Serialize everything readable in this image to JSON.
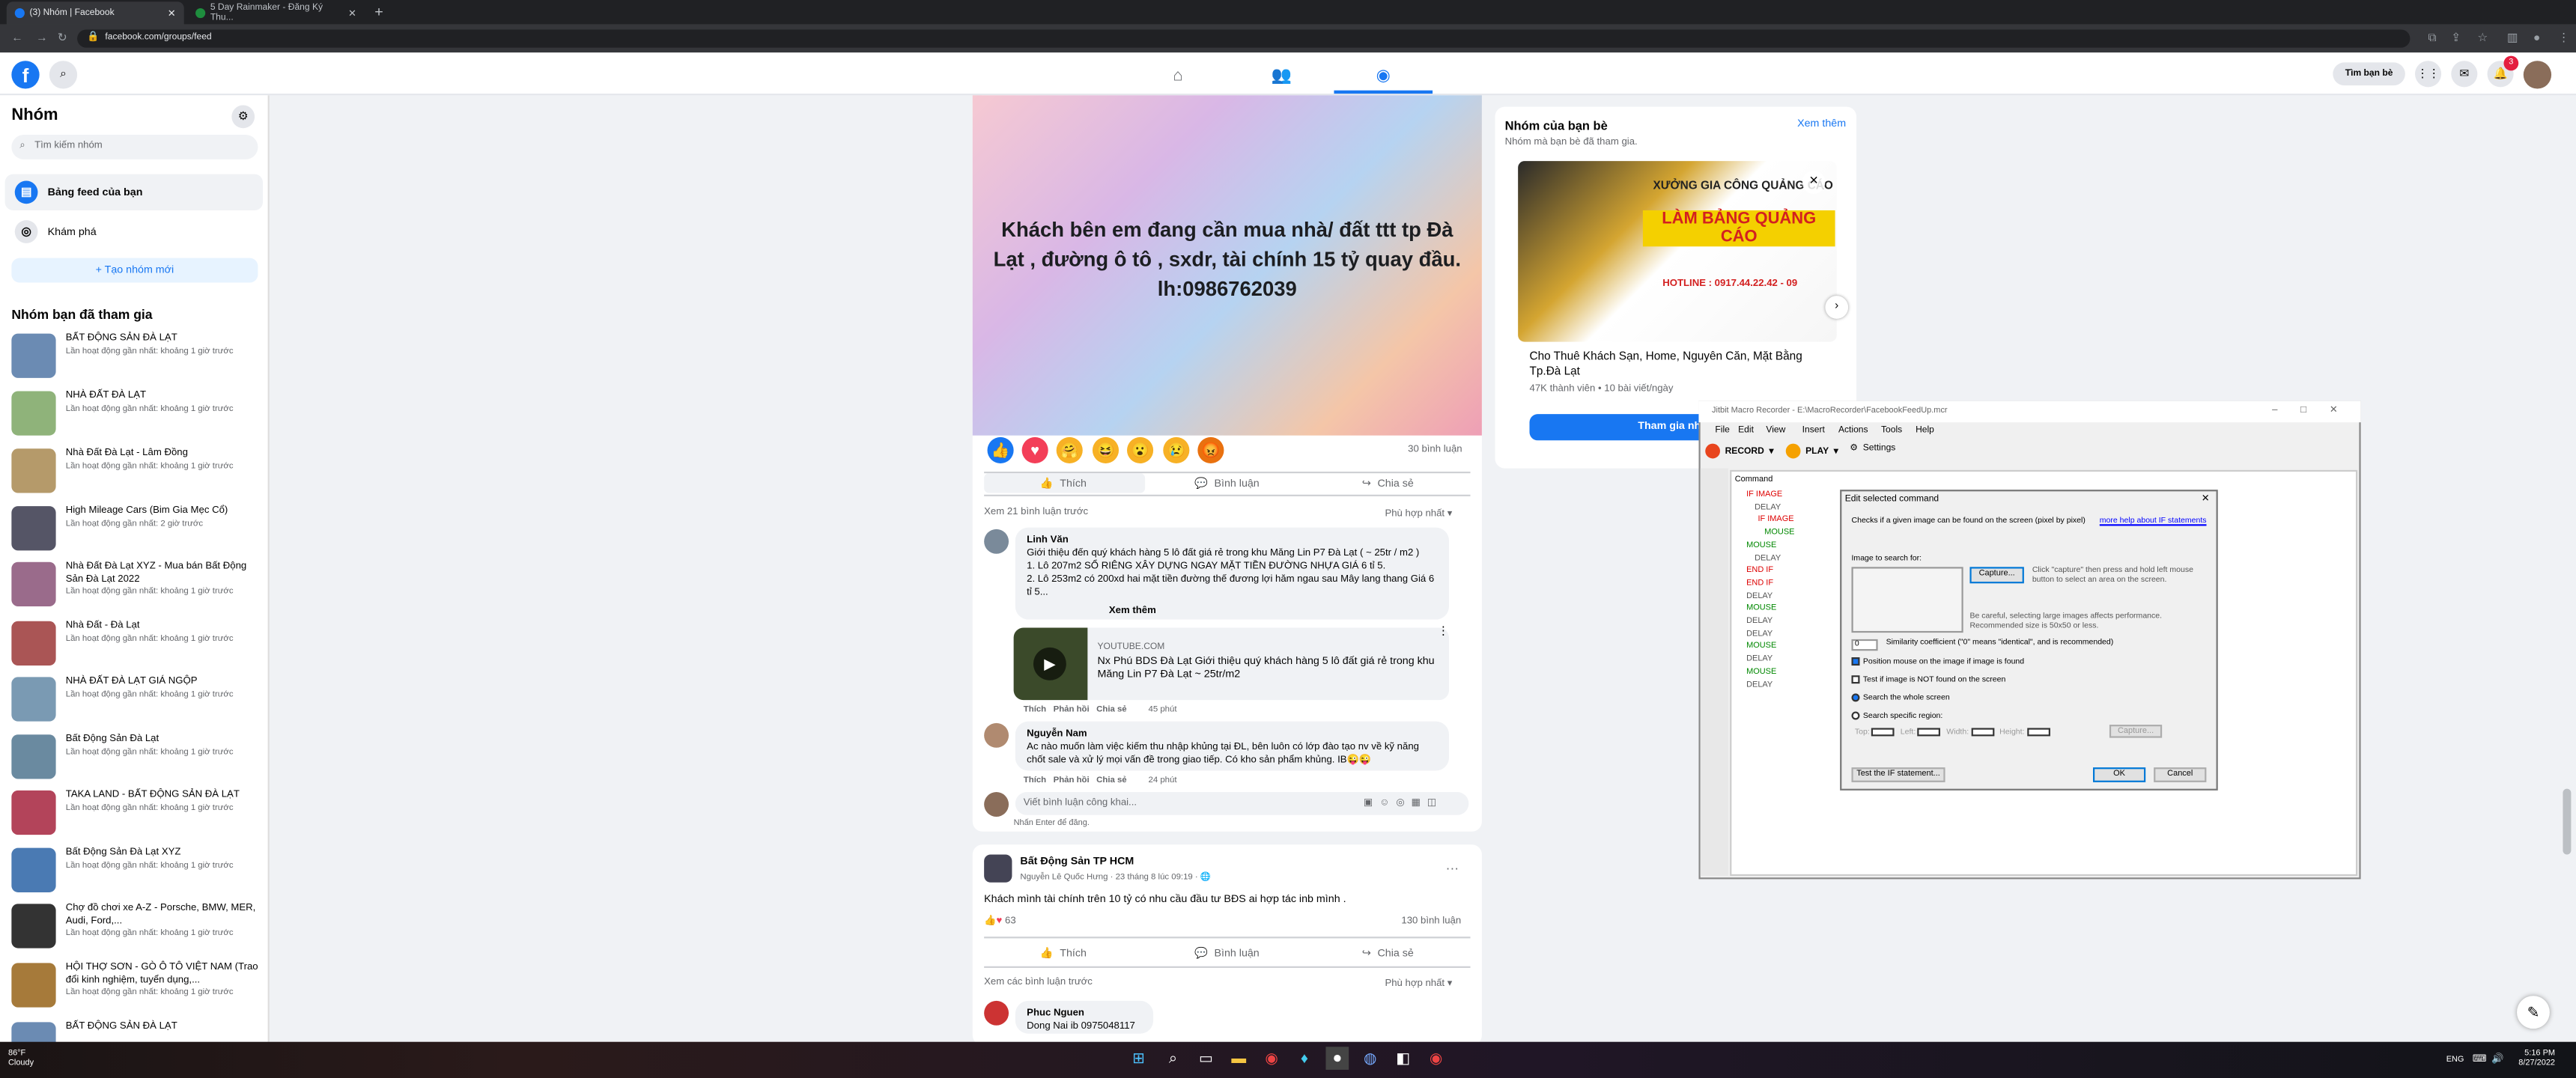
{
  "browser": {
    "tabs": [
      {
        "title": "(3) Nhóm | Facebook"
      },
      {
        "title": "5 Day Rainmaker - Đăng Ký Thu..."
      }
    ],
    "url": "facebook.com/groups/feed"
  },
  "header": {
    "find_friends": "Tìm bạn bè",
    "notif_count": "3"
  },
  "sidebar": {
    "title": "Nhóm",
    "search_placeholder": "Tìm kiếm nhóm",
    "feed_label": "Bảng feed của bạn",
    "discover_label": "Khám phá",
    "create_label": "+ Tạo nhóm mới",
    "joined_heading": "Nhóm bạn đã tham gia",
    "groups": [
      {
        "name": "BẤT ĐỘNG SẢN ĐÀ LẠT",
        "activity": "Lần hoạt động gần nhất: khoảng 1 giờ trước"
      },
      {
        "name": "NHÀ ĐẤT ĐÀ LẠT",
        "activity": "Lần hoạt động gần nhất: khoảng 1 giờ trước"
      },
      {
        "name": "Nhà Đất Đà Lạt - Lâm Đồng",
        "activity": "Lần hoạt động gần nhất: khoảng 1 giờ trước"
      },
      {
        "name": "High Mileage Cars (Bim Gia Mẹc Cổ)",
        "activity": "Lần hoạt động gần nhất: 2 giờ trước"
      },
      {
        "name": "Nhà Đất Đà Lạt XYZ - Mua bán Bất Động Sản Đà Lạt 2022",
        "activity": "Lần hoạt động gần nhất: khoảng 1 giờ trước"
      },
      {
        "name": "Nhà Đất - Đà Lạt",
        "activity": "Lần hoạt động gần nhất: khoảng 1 giờ trước"
      },
      {
        "name": "NHÀ ĐẤT ĐÀ LẠT GIÁ NGỘP",
        "activity": "Lần hoạt động gần nhất: khoảng 1 giờ trước"
      },
      {
        "name": "Bất Động Sản Đà Lạt",
        "activity": "Lần hoạt động gần nhất: khoảng 1 giờ trước"
      },
      {
        "name": "TAKA LAND - BẤT ĐỘNG SẢN ĐÀ LẠT",
        "activity": "Lần hoạt động gần nhất: khoảng 1 giờ trước"
      },
      {
        "name": "Bất Động Sản Đà Lạt XYZ",
        "activity": "Lần hoạt động gần nhất: khoảng 1 giờ trước"
      },
      {
        "name": "Chợ đồ chơi xe A-Z - Porsche, BMW, MER, Audi, Ford,...",
        "activity": "Lần hoạt động gần nhất: khoảng 1 giờ trước"
      },
      {
        "name": "HỘI THỢ SƠN - GÒ Ô TÔ VIỆT NAM (Trao đổi kinh nghiệm, tuyển dụng,...",
        "activity": "Lần hoạt động gần nhất: khoảng 1 giờ trước"
      },
      {
        "name": "BẤT ĐỘNG SẢN ĐÀ LẠT",
        "activity": ""
      }
    ]
  },
  "post1": {
    "image_text": "Khách bên em đang cần mua nhà/ đất ttt tp Đà Lạt , đường ô tô , sxdr, tài chính 15 tỷ quay đầu. lh:0986762039",
    "comment_count": "30 bình luận",
    "like": "Thích",
    "comment": "Bình luận",
    "share": "Chia sẻ",
    "prev_comments": "Xem 21 bình luận trước",
    "sort": "Phù hợp nhất",
    "c1": {
      "author": "Linh Văn",
      "text1": "Giới thiệu đến quý khách hàng 5 lô đất giá rẻ trong khu Măng Lin P7 Đà Lạt ( ~ 25tr / m2 )",
      "text2": "1. Lô 207m2 SỔ RIÊNG XÂY DỰNG NGAY MẶT TIỀN ĐƯỜNG NHỰA GIÁ 6 tỉ 5.",
      "text3": "2. Lô 253m2 có 200xd hai mặt tiền đường thế đương lợi hăm ngau sau Mây lang thang Giá 6 tỉ 5...",
      "more": "Xem thêm",
      "link_source": "YOUTUBE.COM",
      "link_title": "Nx Phú BDS Đà Lạt Giới thiệu quý khách hàng 5 lô đất giá rẻ trong khu Măng Lin P7 Đà Lạt ~ 25tr/m2",
      "actions": "Thích   Phản hồi   Chia sẻ",
      "time": "45 phút"
    },
    "c2": {
      "author": "Nguyễn Nam",
      "text": "Ac nào muốn làm việc kiếm thu nhập khủng tại ĐL, bên luôn có lớp đào tạo nv về kỹ năng chốt sale và xử lý mọi vấn đề trong giao tiếp. Có kho sản phẩm khủng. IB😜😜",
      "actions": "Thích   Phản hồi   Chia sẻ",
      "time": "24 phút"
    },
    "write_placeholder": "Viết bình luận công khai...",
    "enter_hint": "Nhấn Enter để đăng."
  },
  "post2": {
    "group": "Bất Động Sản TP HCM",
    "author_meta": "Nguyễn Lê Quốc Hưng · 23 tháng 8 lúc 09:19 · 🌐",
    "text": "Khách mình tài chính trên 10 tỷ có nhu cầu đầu tư BĐS ai hợp tác inb mình .",
    "reactions": "63",
    "comment_count": "130 bình luận",
    "like": "Thích",
    "comment": "Bình luận",
    "share": "Chia sẻ",
    "see_comments": "Xem các bình luận trước",
    "sort": "Phù hợp nhất",
    "c1_author": "Phuc Nguen",
    "c1_text": "Dong Nai ib 0975048117"
  },
  "right": {
    "title": "Nhóm của bạn bè",
    "see_more": "Xem thêm",
    "subtitle": "Nhóm mà bạn bè đã tham gia.",
    "ad_line1": "XƯỞNG GIA CÔNG QUẢNG CÁO",
    "ad_line2": "LÀM BẢNG QUẢNG CÁO",
    "ad_hotline": "HOTLINE : 0917.44.22.42 - 09",
    "group_name": "Cho Thuê Khách Sạn, Home, Nguyên Căn, Mặt Bằng Tp.Đà Lạt",
    "members": "47K thành viên • 10 bài viết/ngày",
    "join": "Tham gia nhóm"
  },
  "recorder": {
    "title": "Jitbit Macro Recorder - E:\\MacroRecorder\\FacebookFeedUp.mcr",
    "menus": [
      "File",
      "Edit",
      "View",
      "Insert",
      "Actions",
      "Tools",
      "Help"
    ],
    "record": "RECORD",
    "play": "PLAY",
    "settings": "Settings",
    "col": "Command",
    "commands": [
      "IF IMAGE",
      "DELAY",
      "IF IMAGE",
      "MOUSE",
      "MOUSE",
      "DELAY",
      "END IF",
      "END IF",
      "DELAY",
      "MOUSE",
      "DELAY",
      "DELAY",
      "MOUSE",
      "DELAY",
      "MOUSE",
      "DELAY"
    ]
  },
  "dialog": {
    "title": "Edit selected command",
    "desc": "Checks if a given image can be found on the screen (pixel by pixel)",
    "help": "more help about IF statements",
    "image_label": "Image to search for:",
    "capture": "Capture...",
    "capture_hint": "Click \"capture\" then press and hold left mouse button to select an area on the screen.",
    "warn": "Be careful, selecting large images affects performance. Recommended size is 50x50 or less.",
    "similarity_val": "0",
    "similarity": "Similarity coefficient (\"0\" means \"identical\", and is recommended)",
    "opt1": "Position mouse on the image if image is found",
    "opt2": "Test if image is NOT found on the screen",
    "opt3": "Search the whole screen",
    "opt4": "Search specific region:",
    "top": "Top:",
    "left": "Left:",
    "width": "Width:",
    "height": "Height:",
    "zero": "0",
    "capture2": "Capture...",
    "test": "Test the IF statement...",
    "ok": "OK",
    "cancel": "Cancel"
  },
  "taskbar": {
    "temp": "86°F",
    "weather": "Cloudy",
    "lang": "ENG",
    "time": "5:16 PM",
    "date": "8/27/2022"
  }
}
